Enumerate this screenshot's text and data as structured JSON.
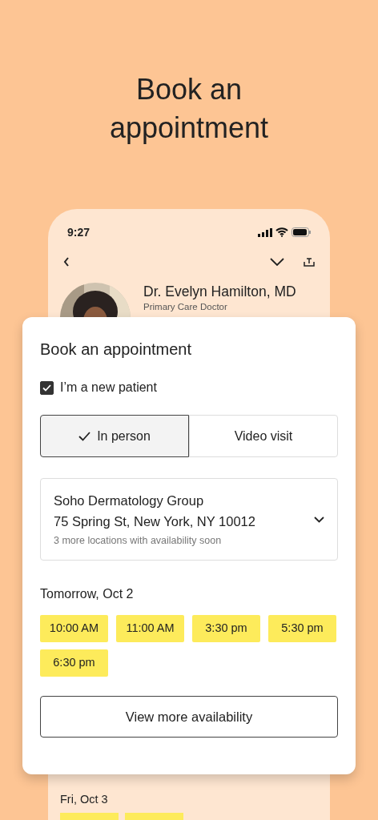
{
  "headline": "Book an appointment",
  "status_bar": {
    "time": "9:27"
  },
  "doctor": {
    "name": "Dr. Evelyn Hamilton, MD",
    "specialty": "Primary Care Doctor"
  },
  "booking": {
    "title": "Book an appointment",
    "new_patient": {
      "label": "I’m a new patient",
      "checked": true
    },
    "visit_types": [
      {
        "label": "In person",
        "selected": true
      },
      {
        "label": "Video visit",
        "selected": false
      }
    ],
    "location": {
      "name": "Soho Dermatology Group",
      "address": "75 Spring St, New York, NY 10012",
      "note": "3 more locations with availability soon"
    },
    "day": "Tomorrow, Oct 2",
    "slots": [
      "10:00 AM",
      "11:00 AM",
      "3:30 pm",
      "5:30 pm",
      "6:30 pm"
    ],
    "more_button": "View more availability"
  },
  "next_day": {
    "day": "Fri, Oct 3"
  }
}
